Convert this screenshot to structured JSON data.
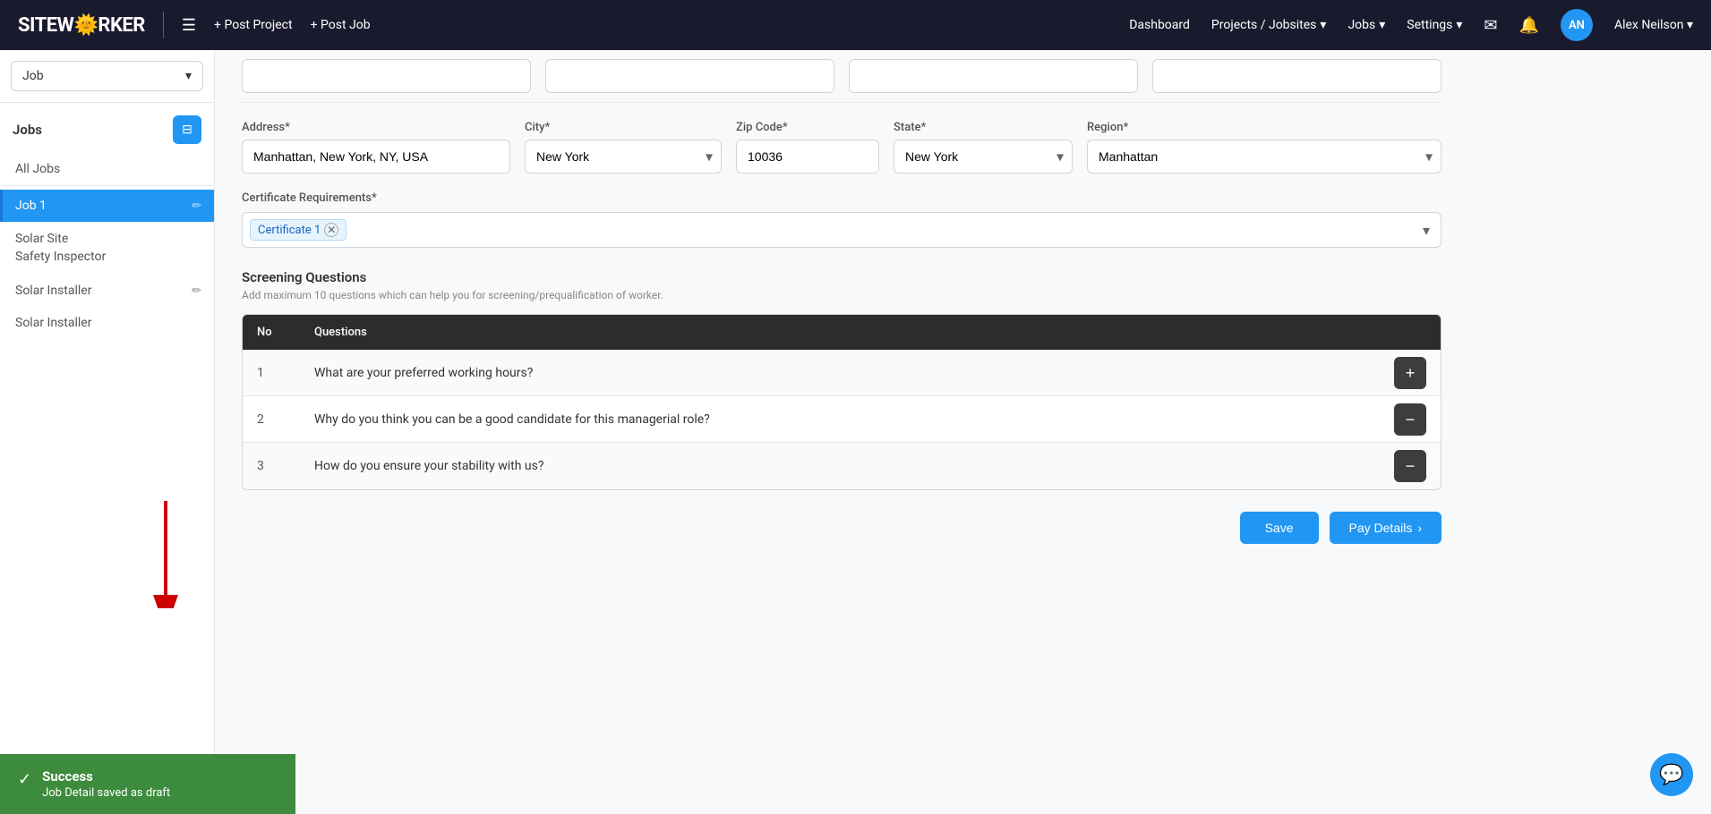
{
  "header": {
    "logo_text": "SITEW",
    "logo_highlight": "🌞",
    "logo_suffix": "RKER",
    "post_project": "+ Post Project",
    "post_job": "+ Post Job",
    "nav": {
      "dashboard": "Dashboard",
      "projects_jobsites": "Projects / Jobsites",
      "jobs": "Jobs",
      "settings": "Settings"
    },
    "user": {
      "initials": "AN",
      "name": "Alex Neilson"
    }
  },
  "sidebar": {
    "dropdown_value": "Job",
    "jobs_title": "Jobs",
    "filter_icon": "⊟",
    "items": [
      {
        "label": "All Jobs",
        "active": false
      },
      {
        "label": "Job 1",
        "active": true
      },
      {
        "label": "Solar Site\nSafety Inspector",
        "active": false
      },
      {
        "label": "Solar Installer",
        "active": false
      },
      {
        "label": "Solar Installer",
        "active": false
      }
    ]
  },
  "form": {
    "address_label": "Address*",
    "address_value": "Manhattan, New York, NY, USA",
    "city_label": "City*",
    "city_value": "New York",
    "zip_label": "Zip Code*",
    "zip_value": "10036",
    "state_label": "State*",
    "state_value": "New York",
    "region_label": "Region*",
    "region_value": "Manhattan"
  },
  "certificate": {
    "label": "Certificate Requirements*",
    "tag": "Certificate 1"
  },
  "screening": {
    "title": "Screening Questions",
    "subtitle": "Add maximum 10 questions which can help you for screening/prequalification of worker.",
    "table_header_no": "No",
    "table_header_questions": "Questions",
    "questions": [
      {
        "no": "1",
        "text": "What are your preferred working hours?"
      },
      {
        "no": "2",
        "text": "Why do you think you can be a good candidate for this managerial role?"
      },
      {
        "no": "3",
        "text": "How do you ensure your stability with us?"
      }
    ]
  },
  "buttons": {
    "save": "Save",
    "pay_details": "Pay Details"
  },
  "toast": {
    "title": "Success",
    "message": "Job Detail saved as draft"
  }
}
